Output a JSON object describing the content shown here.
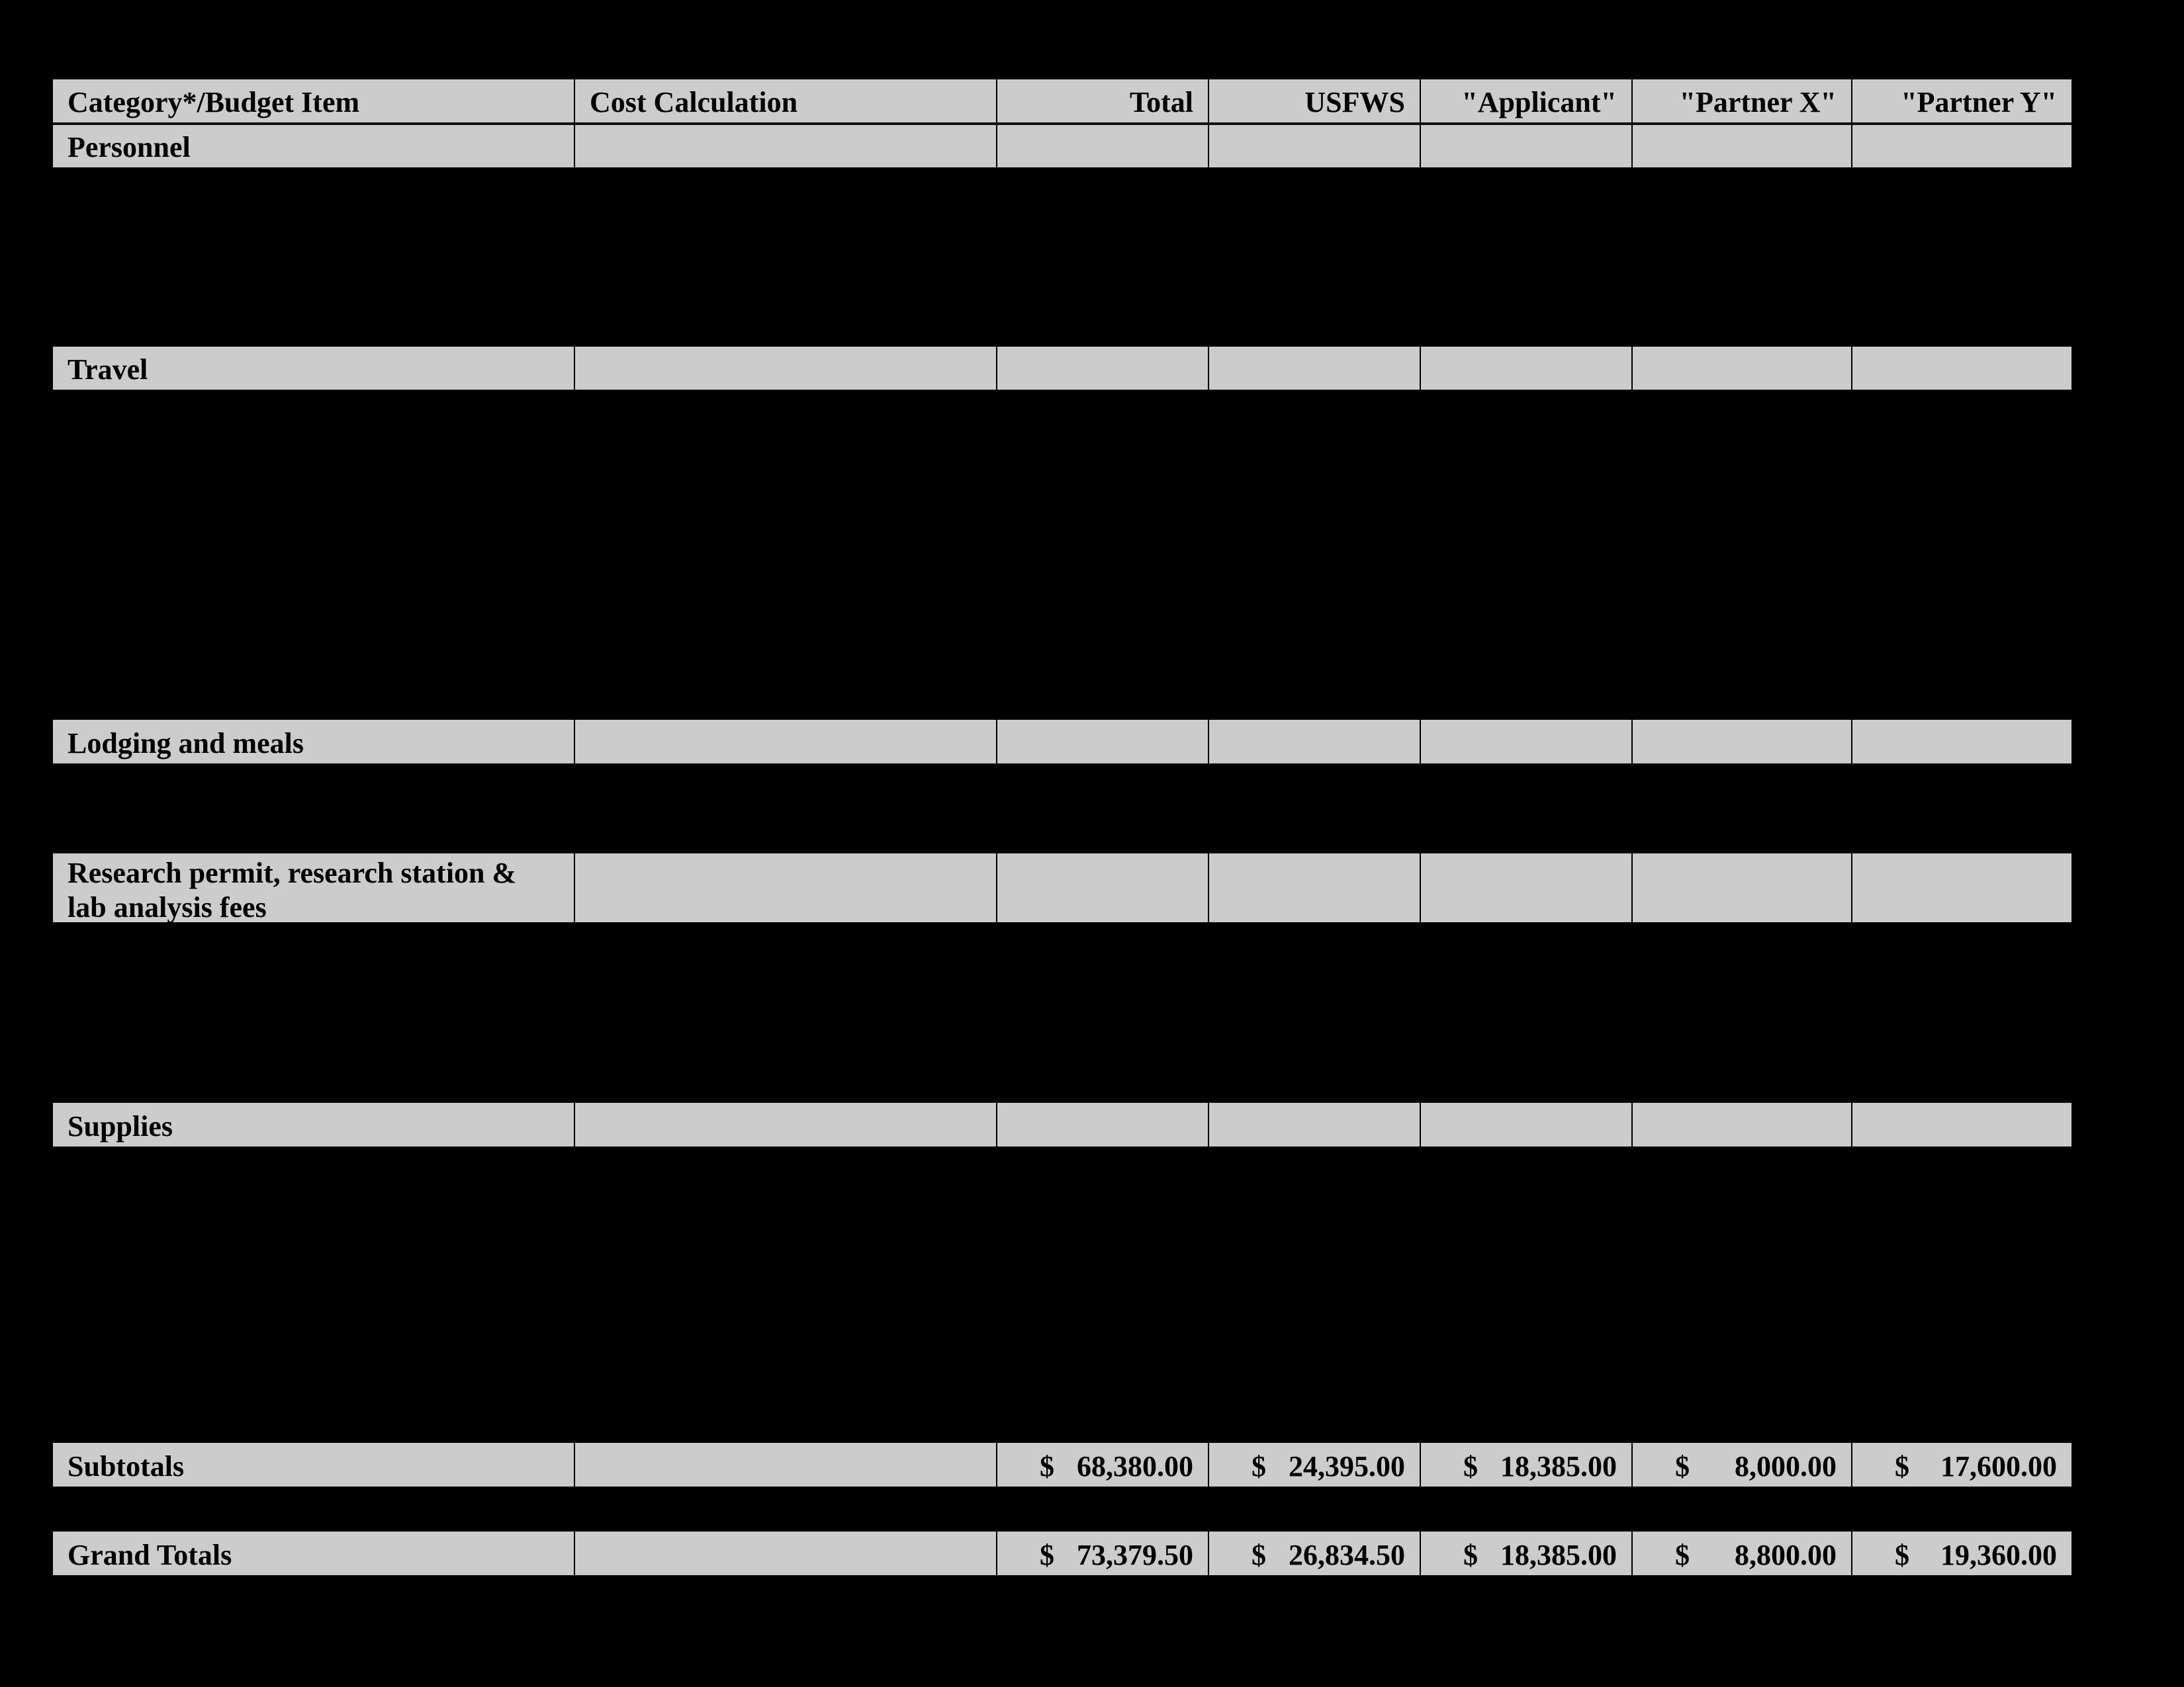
{
  "table": {
    "headers": [
      "Category*/Budget Item",
      "Cost Calculation",
      "Total",
      "USFWS",
      "\"Applicant\"",
      "\"Partner X\"",
      "\"Partner Y\""
    ],
    "categories": [
      {
        "label": "Personnel"
      },
      {
        "label": "Travel"
      },
      {
        "label": "Lodging and meals"
      },
      {
        "label": "Research permit, research station & lab analysis fees"
      },
      {
        "label": "Supplies"
      }
    ],
    "subtotals": {
      "label": "Subtotals",
      "currency": "$",
      "values": [
        "68,380.00",
        "24,395.00",
        "18,385.00",
        "8,000.00",
        "17,600.00"
      ]
    },
    "grand_totals": {
      "label": "Grand Totals",
      "currency": "$",
      "values": [
        "73,379.50",
        "26,834.50",
        "18,385.00",
        "8,800.00",
        "19,360.00"
      ]
    }
  }
}
